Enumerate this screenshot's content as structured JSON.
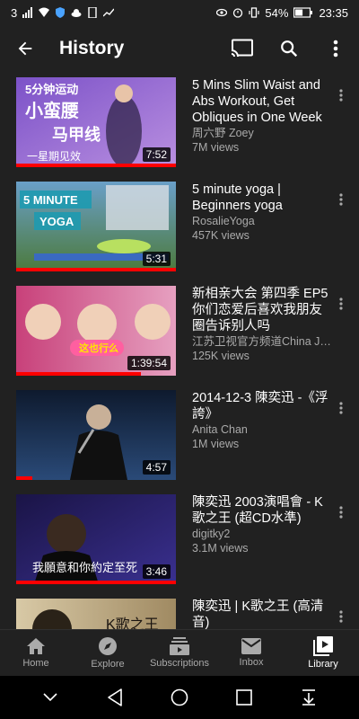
{
  "status_bar": {
    "carrier": "3",
    "battery": "54%",
    "time": "23:35"
  },
  "app_bar": {
    "title": "History",
    "icons": [
      "back-arrow-icon",
      "cast-icon",
      "search-icon",
      "more-vert-icon"
    ]
  },
  "videos": [
    {
      "title": "5 Mins Slim Waist and Abs Workout, Get Obliques in One Week",
      "channel": "周六野 Zoey",
      "views": "7M views",
      "duration": "7:52",
      "watched": 1.0,
      "thumb_text": [
        "5分钟运动",
        "小蛮腰",
        "马甲线",
        "一星期见效"
      ],
      "thumb_colors": [
        "#7c52c8",
        "#b98fe0"
      ]
    },
    {
      "title": "5 minute yoga | Beginners yoga",
      "channel": "RosalieYoga",
      "views": "457K views",
      "duration": "5:31",
      "watched": 1.0,
      "thumb_text": [
        "5 MINUTE",
        "YOGA"
      ],
      "thumb_colors": [
        "#6a9fc8",
        "#4c7a3c"
      ]
    },
    {
      "title": "新相亲大会 第四季 EP5 你们恋爱后喜欢我朋友圈告诉别人吗",
      "channel": "江苏卫视官方频道China Jiangsu TV",
      "views": "125K views",
      "duration": "1:39:54",
      "watched": 0.78,
      "thumb_text": [
        "这也行么"
      ],
      "thumb_colors": [
        "#c8417a",
        "#e6a0c0"
      ]
    },
    {
      "title": "2014-12-3 陳奕迅 -《浮誇》",
      "channel": "Anita Chan",
      "views": "1M views",
      "duration": "4:57",
      "watched": 0.1,
      "thumb_text": [],
      "thumb_colors": [
        "#0e1a2e",
        "#2a4a78"
      ]
    },
    {
      "title": "陳奕迅 2003演唱會 - K歌之王 (超CD水準)",
      "channel": "digitky2",
      "views": "3.1M views",
      "duration": "3:46",
      "watched": 1.0,
      "thumb_text": [
        "我願意和你約定至死"
      ],
      "thumb_colors": [
        "#1a1446",
        "#3a3090"
      ]
    },
    {
      "title": "陳奕迅 | K歌之王 (高清音)",
      "channel": "",
      "views": "",
      "duration": "",
      "watched": 0,
      "thumb_text": [
        "K歌之王"
      ],
      "thumb_colors": [
        "#d8c9a6",
        "#a08a62"
      ]
    }
  ],
  "bottom_nav": [
    {
      "label": "Home",
      "icon": "home-icon",
      "active": false
    },
    {
      "label": "Explore",
      "icon": "compass-icon",
      "active": false
    },
    {
      "label": "Subscriptions",
      "icon": "subscriptions-icon",
      "active": false
    },
    {
      "label": "Inbox",
      "icon": "mail-icon",
      "active": false
    },
    {
      "label": "Library",
      "icon": "library-icon",
      "active": true
    }
  ],
  "system_nav": [
    "collapse-icon",
    "back-triangle-icon",
    "home-circle-icon",
    "recents-square-icon",
    "notification-pull-icon"
  ],
  "colors": {
    "background": "#212121",
    "progress": "#ff0000",
    "secondary_text": "#aaaaaa"
  }
}
